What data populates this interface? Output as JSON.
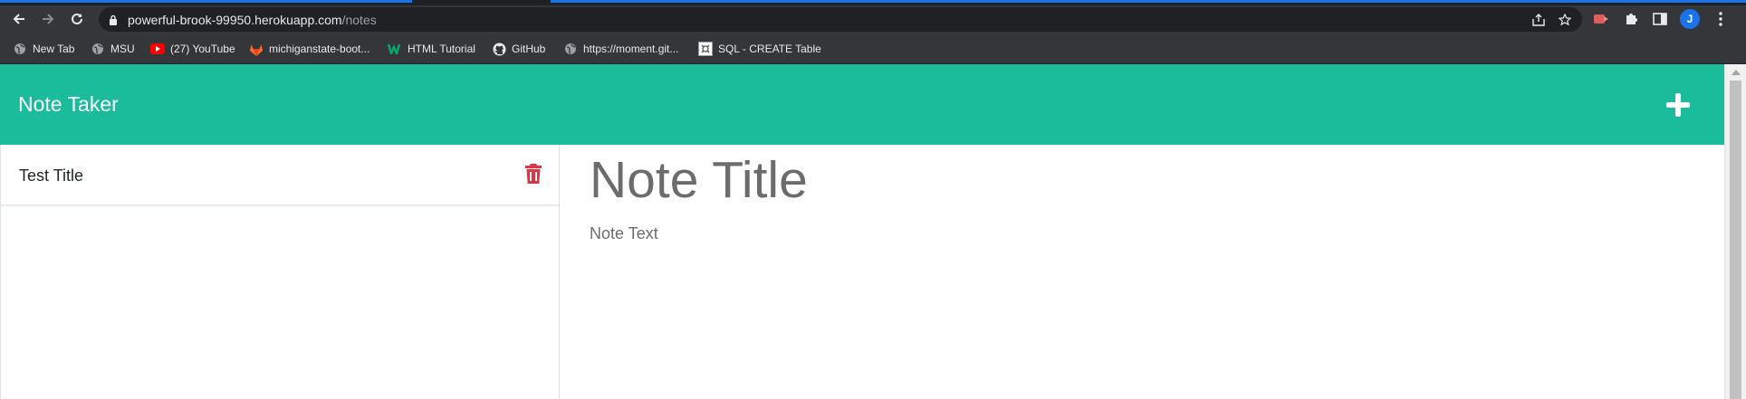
{
  "browser": {
    "url_host": "powerful-brook-99950.herokuapp.com",
    "url_path": "/notes",
    "profile_initial": "J",
    "bookmarks": [
      {
        "label": "New Tab",
        "icon": "globe-icon"
      },
      {
        "label": "MSU",
        "icon": "globe-icon"
      },
      {
        "label": "(27) YouTube",
        "icon": "youtube-icon"
      },
      {
        "label": "michiganstate-boot...",
        "icon": "gitlab-icon"
      },
      {
        "label": "HTML Tutorial",
        "icon": "w3schools-icon"
      },
      {
        "label": "GitHub",
        "icon": "github-icon"
      },
      {
        "label": "https://moment.git...",
        "icon": "globe-icon"
      },
      {
        "label": "SQL - CREATE Table",
        "icon": "sql-icon"
      }
    ]
  },
  "app": {
    "brand": "Note Taker",
    "accent_color": "#1abc9c",
    "delete_color": "#dc3545"
  },
  "notes": [
    {
      "title": "Test Title"
    }
  ],
  "editor": {
    "title_placeholder": "Note Title",
    "text_placeholder": "Note Text"
  }
}
